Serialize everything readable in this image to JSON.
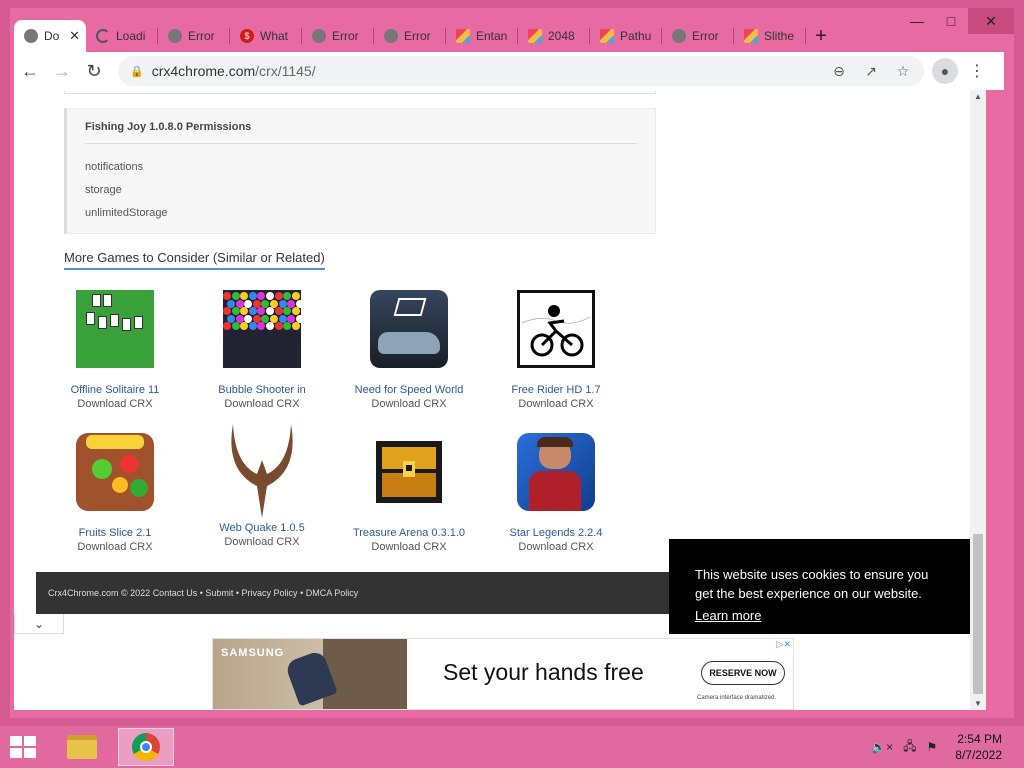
{
  "browser": {
    "tabs": [
      {
        "label": "Do",
        "icon": "globe",
        "active": true
      },
      {
        "label": "Loadi",
        "icon": "loading"
      },
      {
        "label": "Error",
        "icon": "globe"
      },
      {
        "label": "What",
        "icon": "red"
      },
      {
        "label": "Error",
        "icon": "globe"
      },
      {
        "label": "Error",
        "icon": "globe"
      },
      {
        "label": "Entan",
        "icon": "img"
      },
      {
        "label": "2048",
        "icon": "img"
      },
      {
        "label": "Pathu",
        "icon": "img"
      },
      {
        "label": "Error",
        "icon": "globe"
      },
      {
        "label": "Slithe",
        "icon": "img"
      }
    ],
    "new_tab": "+",
    "url_domain": "crx4chrome.com",
    "url_path": "/crx/1145/"
  },
  "permissions": {
    "title": "Fishing Joy 1.0.8.0 Permissions",
    "items": [
      "notifications",
      "storage",
      "unlimitedStorage"
    ]
  },
  "more_heading": "More Games to Consider (Similar or Related)",
  "games": [
    {
      "name": "Offline Solitaire 11",
      "download": "Download CRX"
    },
    {
      "name": "Bubble Shooter in",
      "download": "Download CRX"
    },
    {
      "name": "Need for Speed World",
      "download": "Download CRX"
    },
    {
      "name": "Free Rider HD 1.7",
      "download": "Download CRX"
    },
    {
      "name": "Fruits Slice 2.1",
      "download": "Download CRX"
    },
    {
      "name": "Web Quake 1.0.5",
      "download": "Download CRX"
    },
    {
      "name": "Treasure Arena 0.3.1.0",
      "download": "Download CRX"
    },
    {
      "name": "Star Legends 2.2.4",
      "download": "Download CRX"
    }
  ],
  "footer": {
    "copyright": "Crx4Chrome.com © 2022",
    "links": [
      "Contact Us",
      "Submit",
      "Privacy Policy",
      "DMCA Policy"
    ],
    "sep": " • "
  },
  "cookie": {
    "text": "This website uses cookies to ensure you get the best experience on our website.",
    "learn_more": "Learn more"
  },
  "ad": {
    "brand": "SAMSUNG",
    "headline": "Set your hands free",
    "cta": "RESERVE NOW",
    "disclaimer": "Camera interface dramatized."
  },
  "taskbar": {
    "time": "2:54 PM",
    "date": "8/7/2022"
  }
}
